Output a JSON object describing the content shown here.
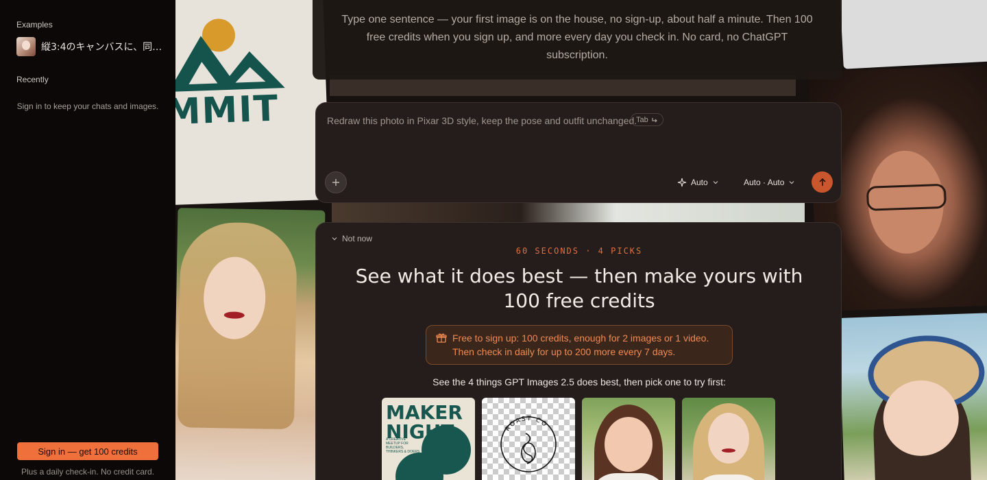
{
  "sidebar": {
    "examples_heading": "Examples",
    "example_item": "縦3:4のキャンバスに、同…",
    "recently_heading": "Recently",
    "recently_hint": "Sign in to keep your chats and images.",
    "signin_button": "Sign in — get 100 credits",
    "footnote": "Plus a daily check-in. No credit card."
  },
  "background": {
    "summit_card_text": "MMIT",
    "night_card_text": "NIGHT"
  },
  "intro": {
    "text": "Type one sentence — your first image is on the house, no sign-up, about half a minute. Then 100 free credits when you sign up, and more every day you check in. No card, no ChatGPT subscription."
  },
  "composer": {
    "placeholder": "Redraw this photo in Pixar 3D style, keep the pose and outfit unchanged.",
    "tab_hint": "Tab",
    "model_label": "Auto",
    "ratio_label": "Auto · Auto",
    "icons": {
      "attach": "plus-icon",
      "model": "sparkle-icon",
      "send": "arrow-up-icon"
    }
  },
  "promo": {
    "dismiss": "Not now",
    "eyebrow": "60 SECONDS · 4 PICKS",
    "title": "See what it does best — then make yours with 100 free credits",
    "offer_line1": "Free to sign up: 100 credits, enough for 2 images or 1 video.",
    "offer_line2": "Then check in daily for up to 200 more every 7 days.",
    "picks_intro": "See the 4 things GPT Images 2.5 does best, then pick one to try first:",
    "picks": [
      {
        "title": "NIGHT",
        "subtitle": "MAKER",
        "small_text": "A CREATIVE MEETUP FOR BUILDERS, THINKERS & DOERS"
      },
      {
        "logo_text": "ROAST CO"
      },
      {},
      {}
    ]
  },
  "colors": {
    "accent": "#f0703b",
    "send_button": "#c9562c",
    "panel": "#241d1b",
    "sidebar": "#0b0807"
  }
}
